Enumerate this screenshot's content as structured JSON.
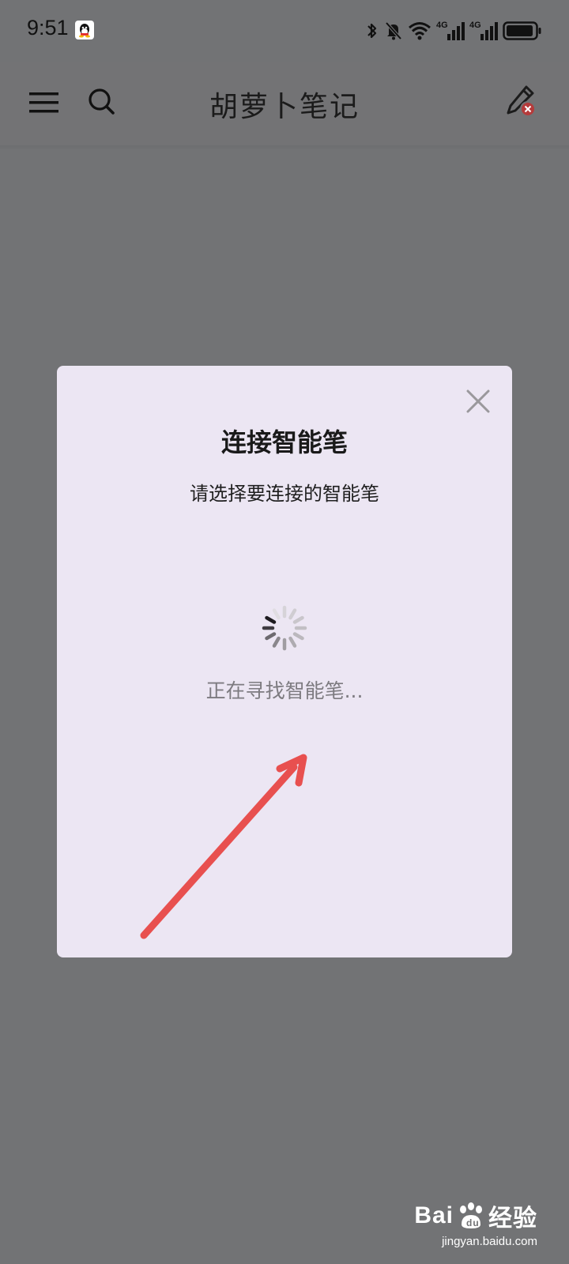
{
  "status_bar": {
    "time": "9:51",
    "icons": [
      "qq-icon",
      "bluetooth-icon",
      "bell-muted-icon",
      "wifi-icon",
      "signal-4g-icon",
      "signal-4g-icon",
      "battery-icon"
    ],
    "network_label_1": "4G",
    "network_label_2": "4G"
  },
  "app_bar": {
    "title": "胡萝卜笔记",
    "icons": [
      "menu-icon",
      "search-icon",
      "pen-disconnected-icon"
    ]
  },
  "dialog": {
    "title": "连接智能笔",
    "subtitle": "请选择要连接的智能笔",
    "status_text": "正在寻找智能笔...",
    "close_icon": "close-icon",
    "spinner_icon": "loading-spinner-icon"
  },
  "annotation": {
    "arrow_color": "#e8504f"
  },
  "watermark": {
    "logo_text_1": "Bai",
    "logo_text_2": "经验",
    "url": "jingyan.baidu.com"
  },
  "colors": {
    "overlay": "#727375",
    "dialog_bg": "#ece6f3",
    "accent_red": "#e8504f"
  }
}
